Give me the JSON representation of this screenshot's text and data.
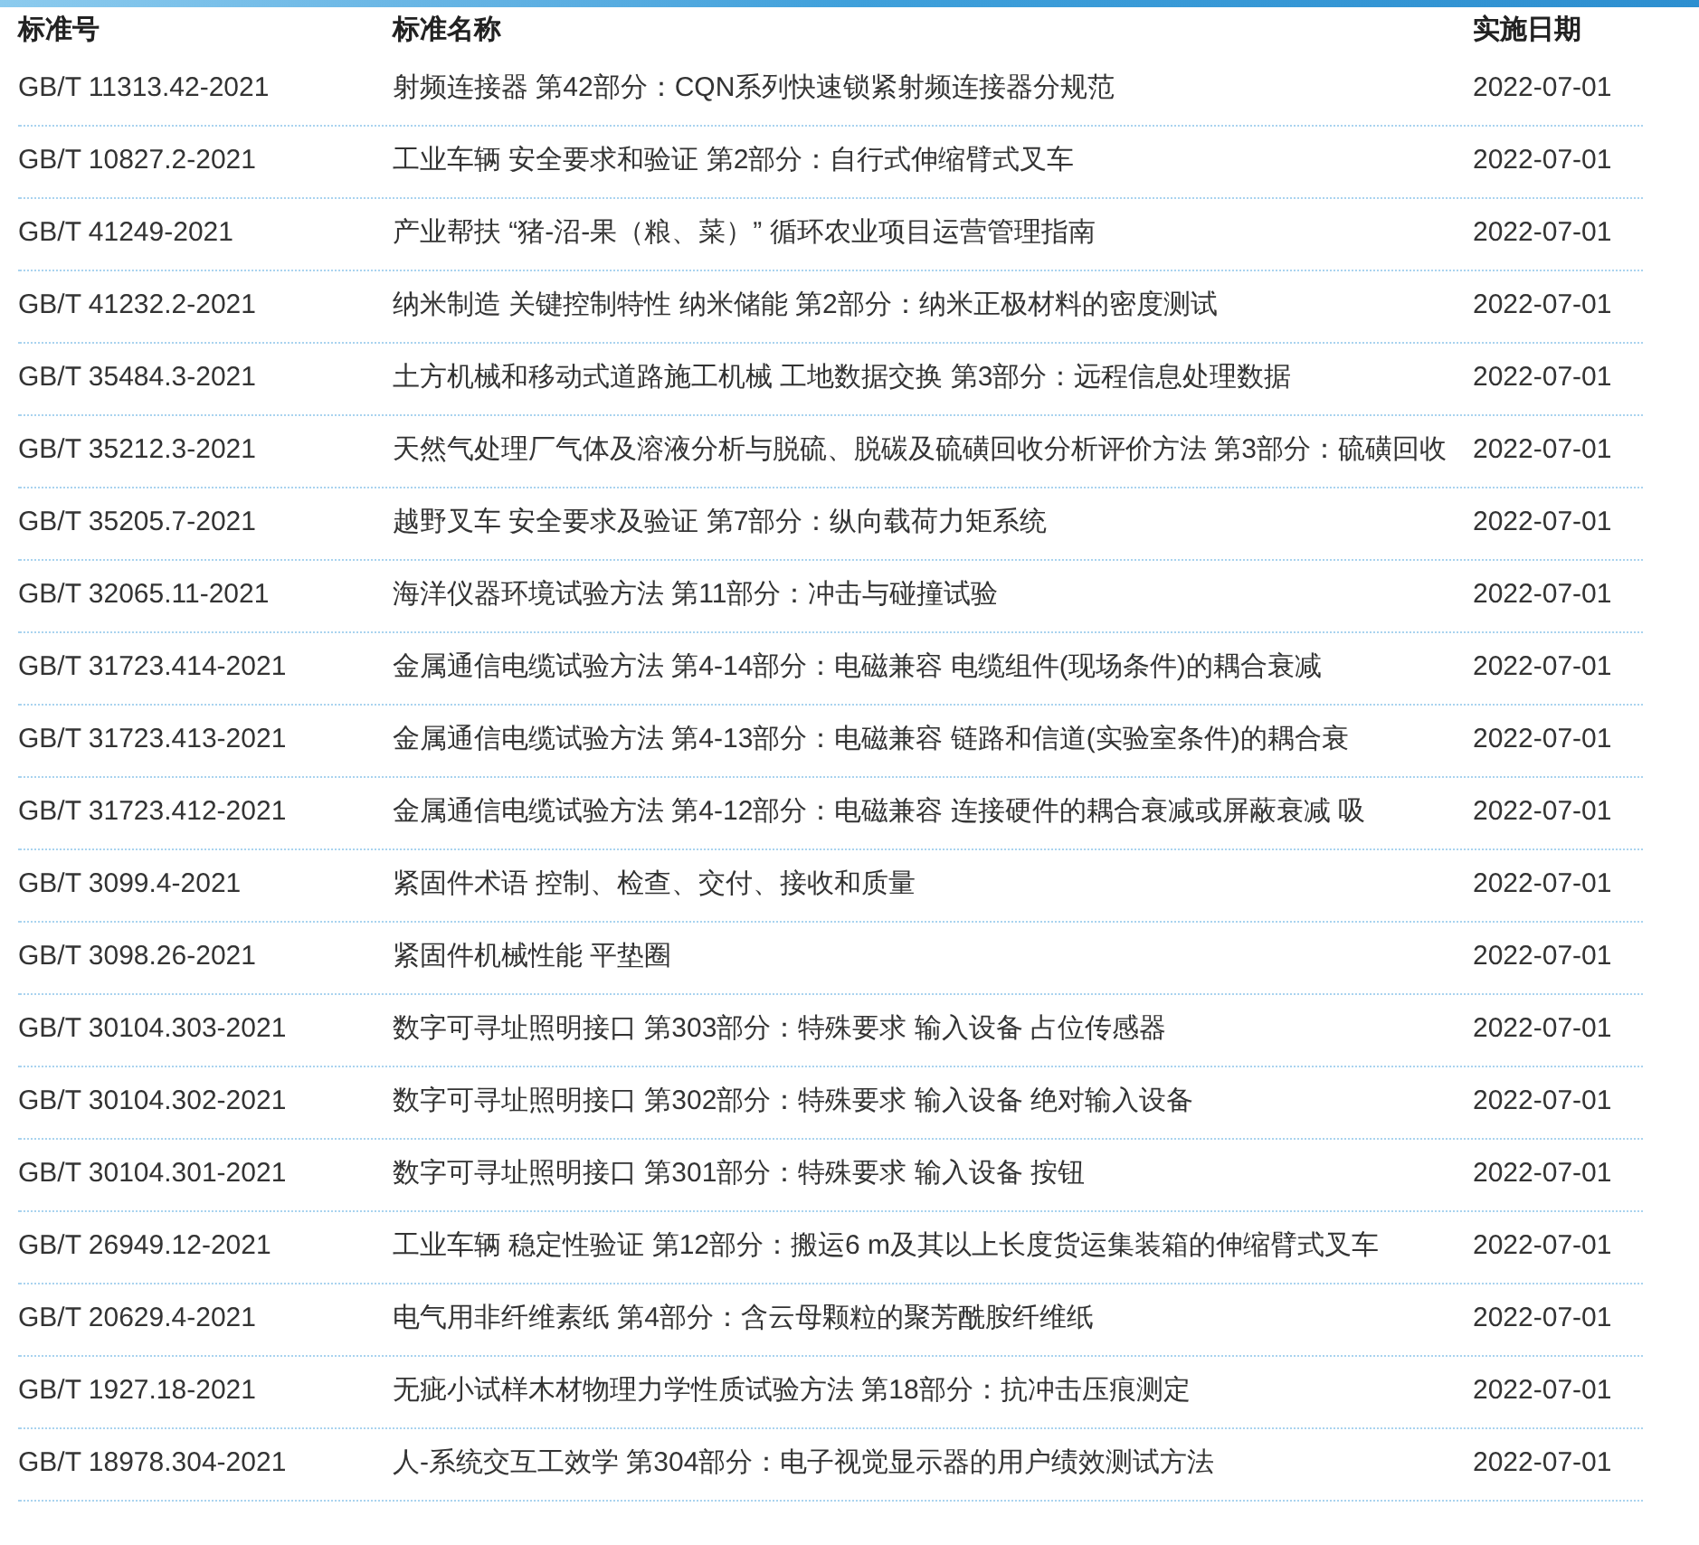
{
  "table": {
    "columns": [
      "标准号",
      "标准名称",
      "实施日期"
    ],
    "rows": [
      {
        "code": "GB/T 11313.42-2021",
        "name": "射频连接器 第42部分：CQN系列快速锁紧射频连接器分规范",
        "date": "2022-07-01"
      },
      {
        "code": "GB/T 10827.2-2021",
        "name": "工业车辆 安全要求和验证 第2部分：自行式伸缩臂式叉车",
        "date": "2022-07-01"
      },
      {
        "code": "GB/T 41249-2021",
        "name": "产业帮扶 “猪-沼-果（粮、菜）” 循环农业项目运营管理指南",
        "date": "2022-07-01"
      },
      {
        "code": "GB/T 41232.2-2021",
        "name": "纳米制造 关键控制特性 纳米储能 第2部分：纳米正极材料的密度测试",
        "date": "2022-07-01"
      },
      {
        "code": "GB/T 35484.3-2021",
        "name": "土方机械和移动式道路施工机械 工地数据交换 第3部分：远程信息处理数据",
        "date": "2022-07-01"
      },
      {
        "code": "GB/T 35212.3-2021",
        "name": "天然气处理厂气体及溶液分析与脱硫、脱碳及硫磺回收分析评价方法 第3部分：硫磺回收",
        "date": "2022-07-01"
      },
      {
        "code": "GB/T 35205.7-2021",
        "name": "越野叉车 安全要求及验证 第7部分：纵向载荷力矩系统",
        "date": "2022-07-01"
      },
      {
        "code": "GB/T 32065.11-2021",
        "name": "海洋仪器环境试验方法 第11部分：冲击与碰撞试验",
        "date": "2022-07-01"
      },
      {
        "code": "GB/T 31723.414-2021",
        "name": "金属通信电缆试验方法 第4-14部分：电磁兼容 电缆组件(现场条件)的耦合衰减",
        "date": "2022-07-01"
      },
      {
        "code": "GB/T 31723.413-2021",
        "name": "金属通信电缆试验方法 第4-13部分：电磁兼容 链路和信道(实验室条件)的耦合衰",
        "date": "2022-07-01"
      },
      {
        "code": "GB/T 31723.412-2021",
        "name": "金属通信电缆试验方法 第4-12部分：电磁兼容 连接硬件的耦合衰减或屏蔽衰减 吸",
        "date": "2022-07-01"
      },
      {
        "code": "GB/T 3099.4-2021",
        "name": "紧固件术语 控制、检查、交付、接收和质量",
        "date": "2022-07-01"
      },
      {
        "code": "GB/T 3098.26-2021",
        "name": "紧固件机械性能 平垫圈",
        "date": "2022-07-01"
      },
      {
        "code": "GB/T 30104.303-2021",
        "name": "数字可寻址照明接口 第303部分：特殊要求 输入设备 占位传感器",
        "date": "2022-07-01"
      },
      {
        "code": "GB/T 30104.302-2021",
        "name": "数字可寻址照明接口 第302部分：特殊要求 输入设备 绝对输入设备",
        "date": "2022-07-01"
      },
      {
        "code": "GB/T 30104.301-2021",
        "name": "数字可寻址照明接口 第301部分：特殊要求 输入设备 按钮",
        "date": "2022-07-01"
      },
      {
        "code": "GB/T 26949.12-2021",
        "name": "工业车辆 稳定性验证 第12部分：搬运6 m及其以上长度货运集装箱的伸缩臂式叉车",
        "date": "2022-07-01"
      },
      {
        "code": "GB/T 20629.4-2021",
        "name": "电气用非纤维素纸 第4部分：含云母颗粒的聚芳酰胺纤维纸",
        "date": "2022-07-01"
      },
      {
        "code": "GB/T 1927.18-2021",
        "name": "无疵小试样木材物理力学性质试验方法 第18部分：抗冲击压痕测定",
        "date": "2022-07-01"
      },
      {
        "code": "GB/T 18978.304-2021",
        "name": "人-系统交互工效学 第304部分：电子视觉显示器的用户绩效测试方法",
        "date": "2022-07-01"
      }
    ]
  }
}
